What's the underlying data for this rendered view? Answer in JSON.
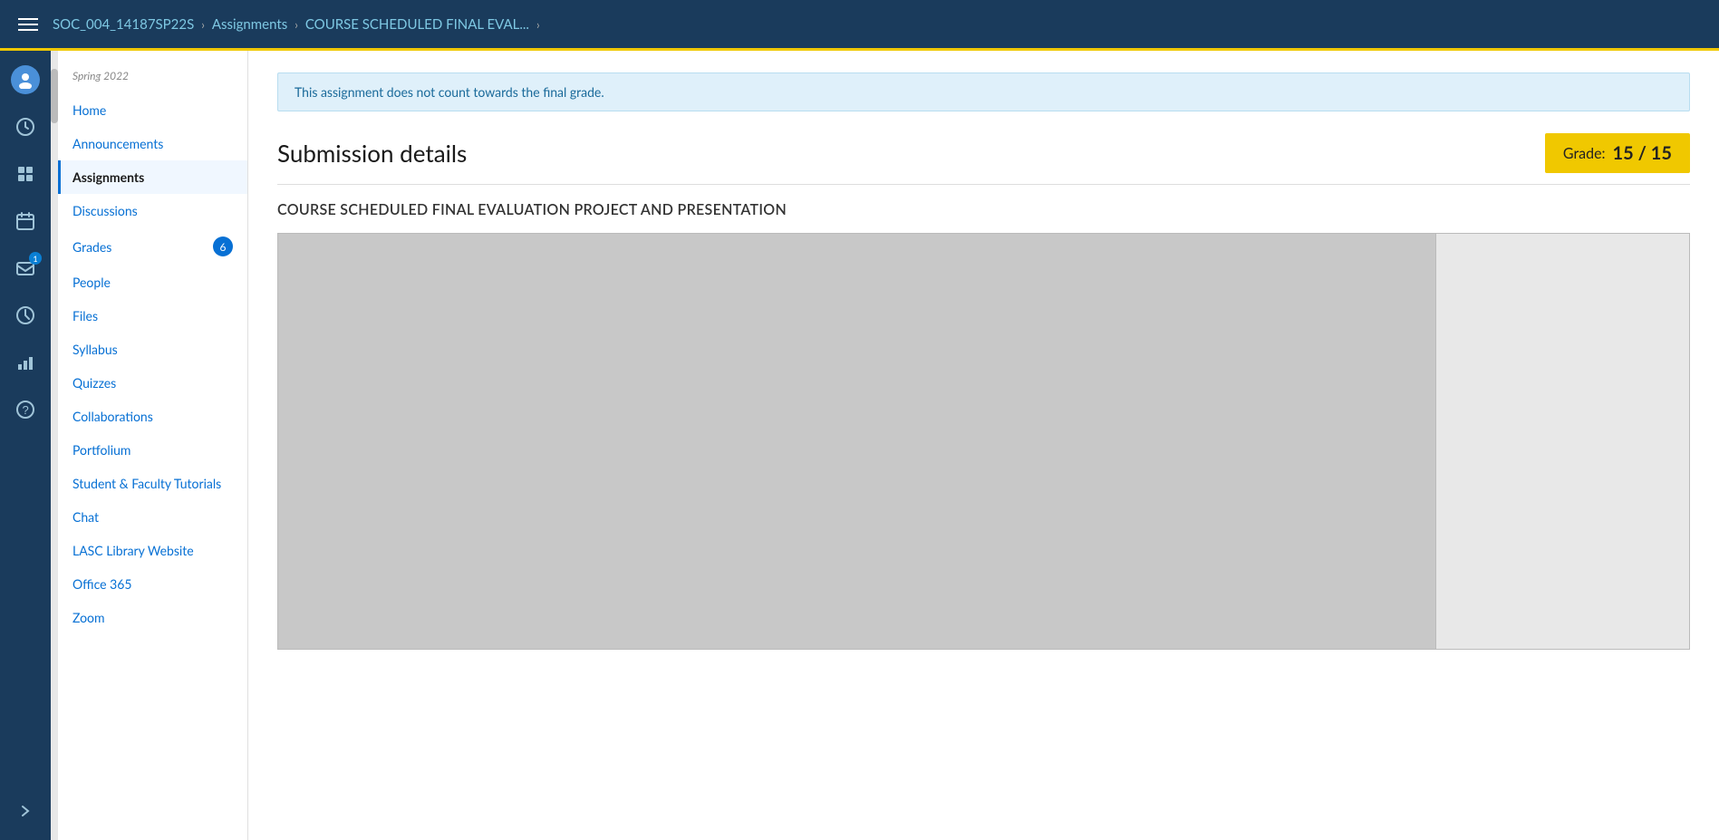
{
  "topbar": {
    "breadcrumbs": [
      {
        "label": "SOC_004_14187SP22S",
        "href": "#"
      },
      {
        "label": "Assignments",
        "href": "#"
      },
      {
        "label": "COURSE SCHEDULED FINAL EVAL...",
        "href": "#"
      }
    ]
  },
  "iconRail": {
    "items": [
      {
        "id": "account",
        "icon": "👤",
        "label": "Account",
        "badge": null
      },
      {
        "id": "dashboard",
        "icon": "⏱",
        "label": "Dashboard",
        "badge": null
      },
      {
        "id": "courses",
        "icon": "📋",
        "label": "Courses",
        "badge": null
      },
      {
        "id": "calendar",
        "icon": "📅",
        "label": "Calendar",
        "badge": null
      },
      {
        "id": "inbox",
        "icon": "📥",
        "label": "Inbox",
        "badge": "1"
      },
      {
        "id": "history",
        "icon": "🕐",
        "label": "History",
        "badge": null
      },
      {
        "id": "analytics",
        "icon": "📊",
        "label": "Analytics",
        "badge": null
      },
      {
        "id": "help",
        "icon": "?",
        "label": "Help",
        "badge": null
      }
    ],
    "collapseLabel": "→"
  },
  "sidebar": {
    "season": "Spring 2022",
    "items": [
      {
        "id": "home",
        "label": "Home",
        "active": false,
        "badge": null
      },
      {
        "id": "announcements",
        "label": "Announcements",
        "active": false,
        "badge": null
      },
      {
        "id": "assignments",
        "label": "Assignments",
        "active": true,
        "badge": null
      },
      {
        "id": "discussions",
        "label": "Discussions",
        "active": false,
        "badge": null
      },
      {
        "id": "grades",
        "label": "Grades",
        "active": false,
        "badge": "6"
      },
      {
        "id": "people",
        "label": "People",
        "active": false,
        "badge": null
      },
      {
        "id": "files",
        "label": "Files",
        "active": false,
        "badge": null
      },
      {
        "id": "syllabus",
        "label": "Syllabus",
        "active": false,
        "badge": null
      },
      {
        "id": "quizzes",
        "label": "Quizzes",
        "active": false,
        "badge": null
      },
      {
        "id": "collaborations",
        "label": "Collaborations",
        "active": false,
        "badge": null
      },
      {
        "id": "portfolium",
        "label": "Portfolium",
        "active": false,
        "badge": null
      },
      {
        "id": "student-faculty-tutorials",
        "label": "Student & Faculty Tutorials",
        "active": false,
        "badge": null
      },
      {
        "id": "chat",
        "label": "Chat",
        "active": false,
        "badge": null
      },
      {
        "id": "lasc-library",
        "label": "LASC Library Website",
        "active": false,
        "badge": null
      },
      {
        "id": "office365",
        "label": "Office 365",
        "active": false,
        "badge": null
      },
      {
        "id": "zoom",
        "label": "Zoom",
        "active": false,
        "badge": null
      }
    ]
  },
  "content": {
    "noticeBanner": "This assignment does not count towards the final grade.",
    "submissionTitle": "Submission details",
    "gradeLabel": "Grade:",
    "gradeValue": "15 / 15",
    "assignmentTitle": "COURSE SCHEDULED FINAL EVALUATION PROJECT AND PRESENTATION"
  }
}
